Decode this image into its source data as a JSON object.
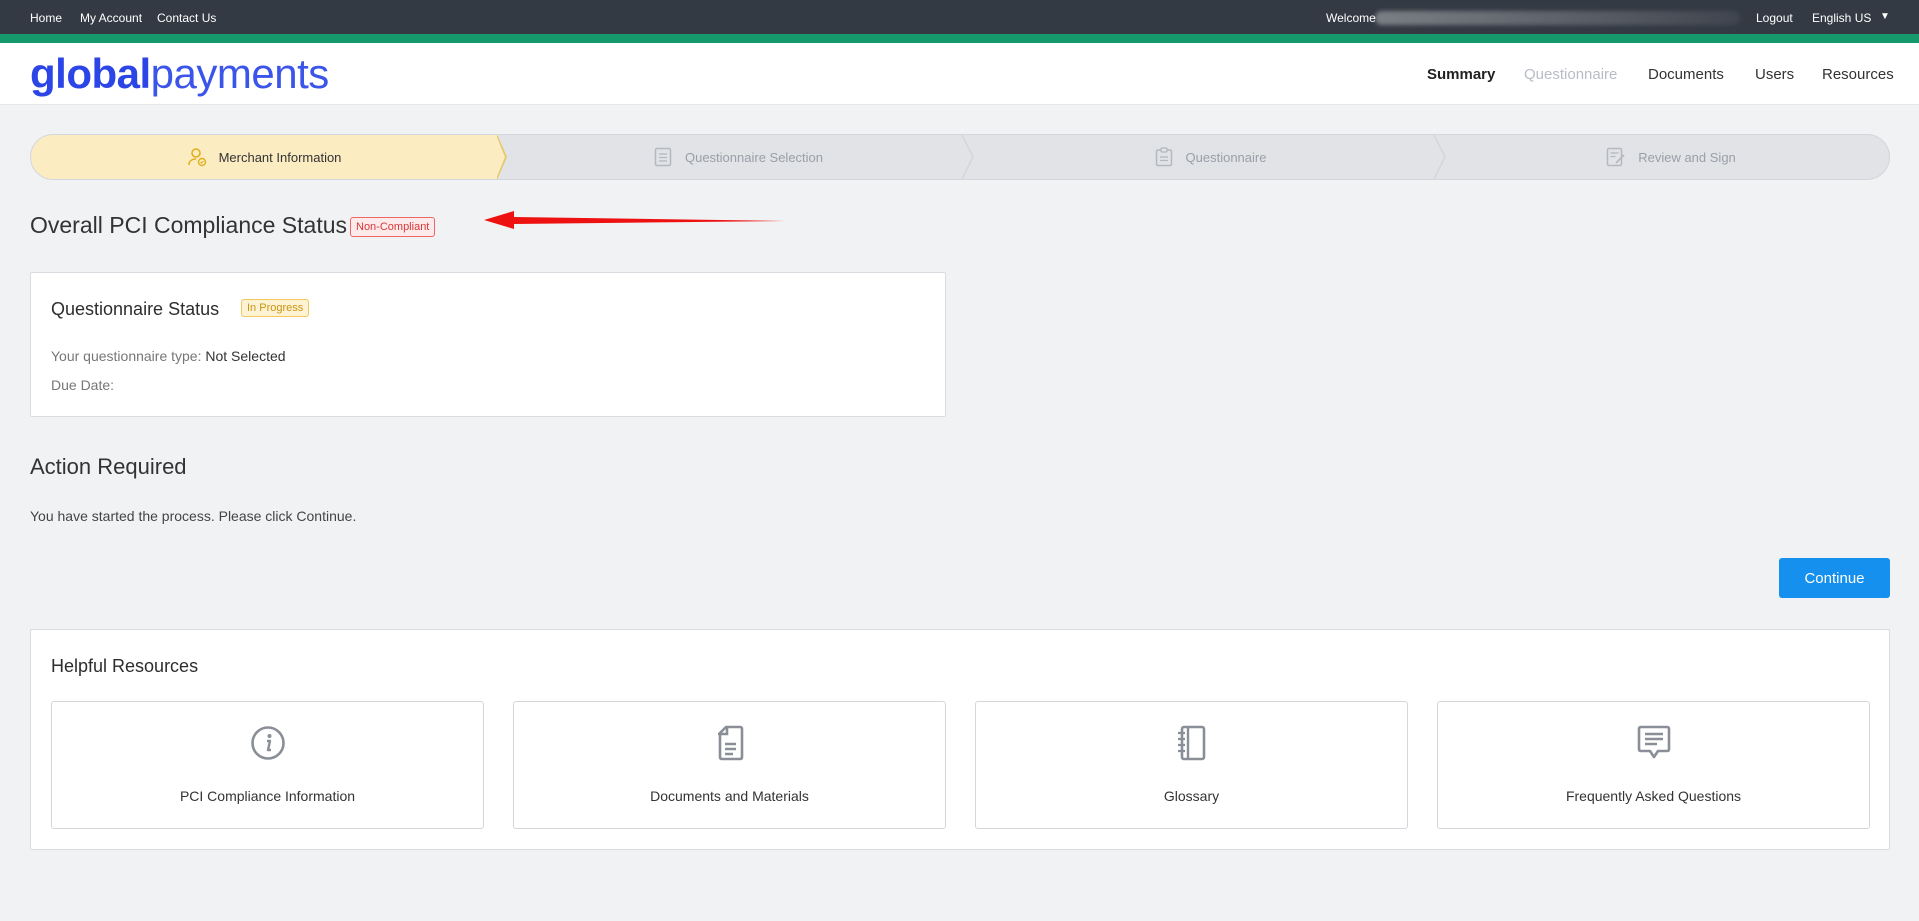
{
  "topbar": {
    "links": [
      "Home",
      "My Account",
      "Contact Us"
    ],
    "welcome": "Welcome",
    "logout": "Logout",
    "language": "English US"
  },
  "logo": {
    "bold": "global",
    "light": "payments"
  },
  "nav": [
    "Summary",
    "Questionnaire",
    "Documents",
    "Users",
    "Resources"
  ],
  "stepper": [
    "Merchant Information",
    "Questionnaire Selection",
    "Questionnaire",
    "Review and Sign"
  ],
  "overall": {
    "title": "Overall PCI Compliance Status",
    "badge": "Non-Compliant"
  },
  "questionnaire_card": {
    "title": "Questionnaire Status",
    "badge": "In Progress",
    "type_label": "Your questionnaire type:",
    "type_value": "Not Selected",
    "due_label": "Due Date:"
  },
  "action": {
    "title": "Action Required",
    "text": "You have started the process. Please click Continue.",
    "button": "Continue"
  },
  "resources": {
    "title": "Helpful Resources",
    "items": [
      {
        "label": "PCI Compliance Information",
        "icon": "info-icon"
      },
      {
        "label": "Documents and Materials",
        "icon": "document-icon"
      },
      {
        "label": "Glossary",
        "icon": "notebook-icon"
      },
      {
        "label": "Frequently Asked Questions",
        "icon": "chat-icon"
      }
    ]
  },
  "colors": {
    "accent": "#1590ee",
    "green": "#16996a",
    "brand": "#2b45e6",
    "danger": "#d8383a",
    "warning": "#c89510"
  }
}
